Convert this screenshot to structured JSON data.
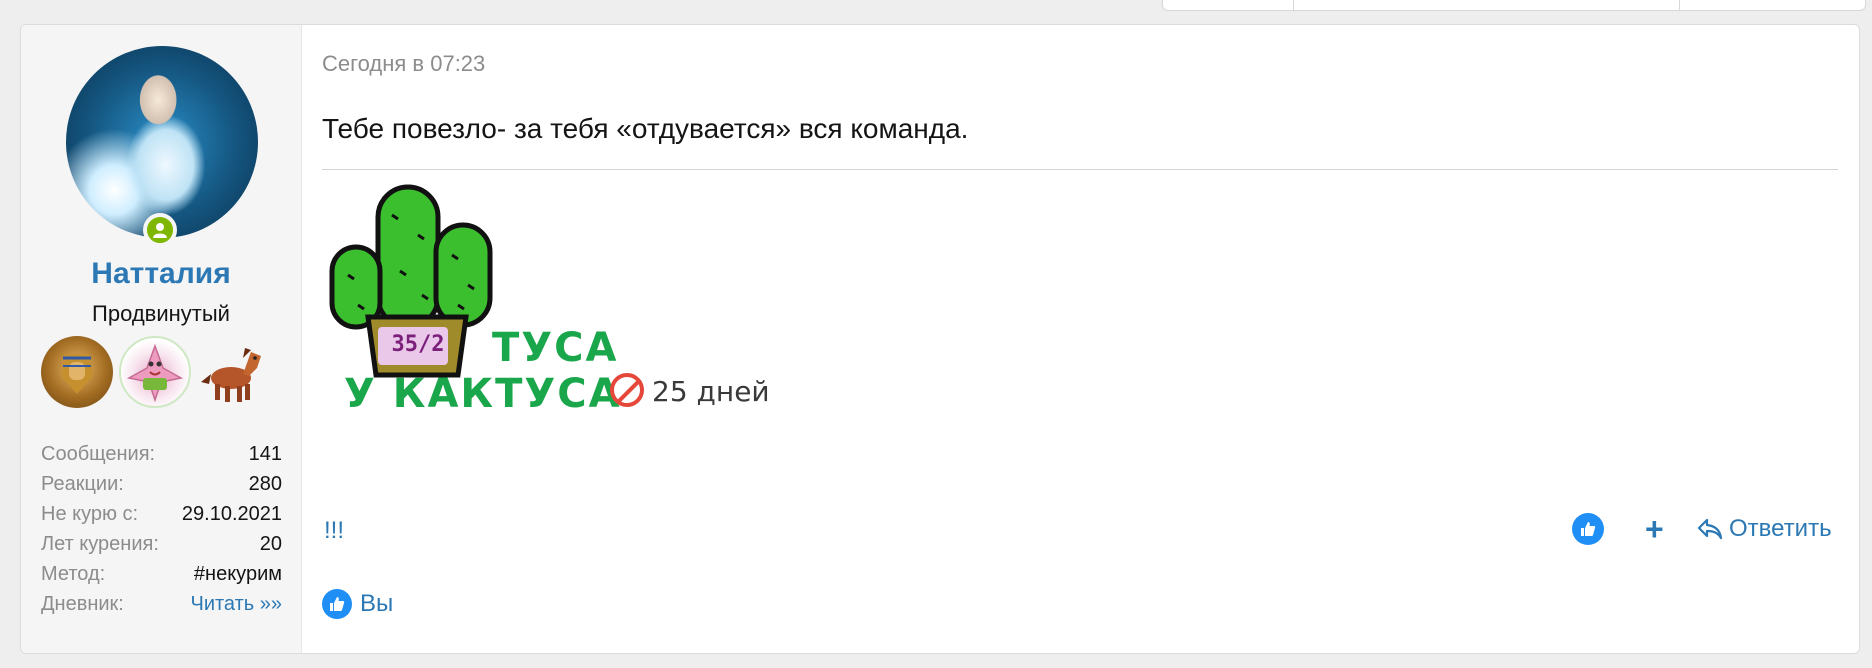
{
  "user": {
    "name": "Натталия",
    "title": "Продвинутый",
    "online_status_icon": "user-online-icon",
    "trophies": [
      "egyptian-trophy-icon",
      "starfish-trophy-icon",
      "horse-trophy-icon"
    ],
    "stats": [
      {
        "label": "Сообщения:",
        "value": "141"
      },
      {
        "label": "Реакции:",
        "value": "280"
      },
      {
        "label": "Не курю с:",
        "value": "29.10.2021"
      },
      {
        "label": "Лет курения:",
        "value": "20"
      },
      {
        "label": "Метод:",
        "value": "#некурим"
      },
      {
        "label": "Дневник:",
        "value": "Читать »»"
      }
    ]
  },
  "post": {
    "timestamp": "Сегодня в 07:23",
    "message": "Тебе повезло- за тебя «отдувается» вся команда.",
    "signature": {
      "pot_label": "35/2",
      "line1": "ТУСА",
      "line2": "У КАКТУСА",
      "days": "25 дней"
    },
    "extra_text": "!!!",
    "actions": {
      "reply": "Ответить"
    },
    "reactions": {
      "reacted_by": "Вы"
    }
  },
  "colors": {
    "accent": "#2b78b4",
    "online": "#7fb700",
    "like": "#1f8ff5",
    "cactus": "#3cbf2f",
    "cactus_text": "#1aa64a",
    "pot": "#a08b2a"
  }
}
